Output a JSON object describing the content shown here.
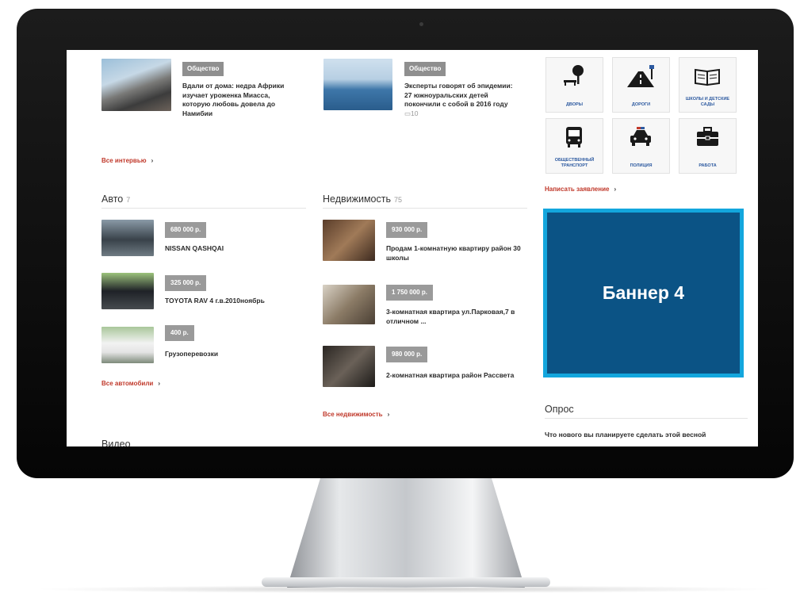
{
  "interviews": [
    {
      "tag": "Общество",
      "title": "Вдали от дома: недра Африки изучает уроженка Миасса, которую любовь довела до Намибии",
      "comments": ""
    },
    {
      "tag": "Общество",
      "title": "Эксперты говорят об эпидемии: 27 южноуральских детей покончили с собой в 2016 году",
      "comments": "10"
    }
  ],
  "interviews_more": "Все интервью",
  "auto": {
    "title": "Авто",
    "count": "7",
    "items": [
      {
        "price": "680 000 р.",
        "title": "NISSAN QASHQAI"
      },
      {
        "price": "325 000 р.",
        "title": "TOYOTA RAV 4 г.в.2010ноябрь"
      },
      {
        "price": "400 р.",
        "title": "Грузоперевозки"
      }
    ],
    "more": "Все автомобили"
  },
  "realty": {
    "title": "Недвижимость",
    "count": "75",
    "items": [
      {
        "price": "930 000 р.",
        "title": "Продам 1-комнатную квартиру район 30 школы"
      },
      {
        "price": "1 750 000 р.",
        "title": "3-комнатная квартира ул.Парковая,7 в отличном ..."
      },
      {
        "price": "980 000 р.",
        "title": "2-комнатная квартира район Рассвета"
      }
    ],
    "more": "Все недвижимость"
  },
  "video": {
    "title": "Видео"
  },
  "complaints": {
    "categories": [
      {
        "label": "дворы",
        "icon": "tree-bench-icon"
      },
      {
        "label": "дороги",
        "icon": "road-icon"
      },
      {
        "label": "школы и детские сады",
        "icon": "book-icon"
      },
      {
        "label": "общественный транспорт",
        "icon": "bus-icon"
      },
      {
        "label": "полиция",
        "icon": "police-car-icon"
      },
      {
        "label": "работа",
        "icon": "briefcase-icon"
      }
    ],
    "write": "Написать заявление"
  },
  "banner": {
    "text": "Баннер 4",
    "bg": "#0b5385",
    "border": "#13a6dd"
  },
  "poll": {
    "title": "Опрос",
    "question": "Что нового вы планируете сделать этой весной"
  },
  "colors": {
    "accent": "#c0392b",
    "tag_bg": "#8f8f8f",
    "icon_label": "#2d5aa0"
  }
}
